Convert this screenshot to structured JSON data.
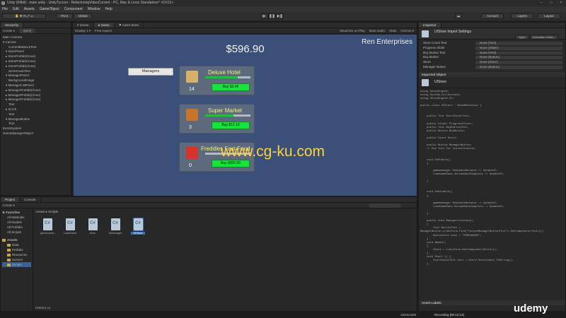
{
  "window": {
    "title": "Unity (64bit) - main.unity - UnityTycoon - RefactoringVideoCurrent - PC, Mac & Linux Standalone* <DX11>",
    "controls": [
      "–",
      "□",
      "×"
    ]
  },
  "menu": [
    "File",
    "Edit",
    "Assets",
    "GameObject",
    "Component",
    "Window",
    "Help"
  ],
  "toolbar": {
    "pivot": "Pivot",
    "global": "Global",
    "account": "Account",
    "layers": "Layers",
    "layout": "Layout",
    "play_buttons": [
      "▶",
      "❚❚",
      "▶❚"
    ]
  },
  "hierarchy": {
    "tab": "Hierarchy",
    "create": "Create ▾",
    "search": "Q▾All",
    "items": [
      "Main Camera",
      "▾ Canvas",
      "CurrentBalanceText",
      "▾ StorePanel",
      "▸ StorePrefab(Clone)",
      "▸ StorePrefab(Clone)",
      "▸ StorePrefab(Clone)",
      "StoreCountText",
      "▾ ManagerPanel",
      "BackgroundImage",
      "▾ ManagerListPanel",
      "▸ ManagerPrefab(Clone)",
      "▸ ManagerPrefab(Clone)",
      "▸ ManagerPrefab(Clone)",
      "Text",
      "▸ Scroll",
      "Text",
      "▾ ManagerButton",
      "Text",
      "EventSystem",
      "GameManagerObject"
    ]
  },
  "scene_tabs": [
    "# Scene",
    "● Game",
    "⚑ Asset Store"
  ],
  "game_bar": {
    "display": "Display 1 ▾",
    "aspect": "Free Aspect",
    "options": [
      "Maximize on Play",
      "Mute audio",
      "Stats",
      "Gizmos ▾"
    ]
  },
  "game": {
    "balance": "$596.90",
    "company": "Ren Enterprises",
    "managers_button": "Managers",
    "stores": [
      {
        "name": "Deluxe Hotel",
        "count": "14",
        "buy": "Buy $3.40",
        "progress": 0.72,
        "icon": "hotel-icon"
      },
      {
        "name": "Super Market",
        "count": "3",
        "buy": "Buy $12.10",
        "progress": 0.62,
        "icon": "market-icon"
      },
      {
        "name": "Freddies Fast Food",
        "count": "0",
        "buy": "Buy $300.00",
        "progress": 0.0,
        "icon": "fries-icon"
      }
    ]
  },
  "watermark": "www.cg-ku.com",
  "project": {
    "tabs": [
      "Project",
      "Console"
    ],
    "create": "Create ▾",
    "breadcrumb": "Assets ▸ Scripts",
    "favorites_label": "Favorites",
    "favorites": [
      "All Materials",
      "All Models",
      "All Prefabs",
      "All Scripts"
    ],
    "assets_label": "Assets",
    "folders": [
      "Data",
      "Prefabs",
      "Resources",
      "Scenes",
      "Scripts"
    ],
    "files": [
      "gamemana...",
      "LoadGame",
      "store",
      "UIManager",
      "UIStore"
    ],
    "selected_file": "UIStore.cs"
  },
  "inspector": {
    "tab": "Inspector",
    "header": "UIStore Import Settings",
    "open": "Open",
    "execution_order": "Execution Order...",
    "fields": [
      {
        "key": "Store Count Text",
        "value": "None (Text)"
      },
      {
        "key": "Progress Slider",
        "value": "None (Slider)"
      },
      {
        "key": "Buy Button Text",
        "value": "None (Text)"
      },
      {
        "key": "Buy Button",
        "value": "None (Button)"
      },
      {
        "key": "Store",
        "value": "None (Store)"
      },
      {
        "key": "Manager Button",
        "value": "None (Button)"
      }
    ],
    "imported_object": "Imported Object",
    "script_name": "UIStore",
    "asset_labels": "Asset Labels",
    "code": [
      "using UnityEngine;",
      "using System.Collections;",
      "using UnityEngine.UI;",
      "",
      "public class UIStore : MonoBehaviour {",
      "",
      "",
      "    public Text StoreCountText;",
      "",
      "    public Slider ProgressSlider;",
      "    public Text BuyButtonText;",
      "    public Button BuyButton;",
      "",
      "    public Store Store;",
      "",
      "    public Button ManagerButton;",
      "    // Use this for initialization",
      "",
      "",
      "    void OnEnable()",
      "    {",
      "",
      "        gamemanager.OnUpdateBalance += UpdateUI;",
      "        LoadGameData.OnLoadDataComplete += UpdateUI;",
      "",
      "    }",
      "",
      "",
      "    void OnDisable()",
      "    {",
      "",
      "        gamemanager.OnUpdateBalance -= UpdateUI;",
      "        LoadGameData.OnLoadDataComplete -= UpdateUI;",
      "",
      "    }",
      "",
      "    public void ManagerUnlocked()",
      "    {",
      "        Text ButtonText =",
      "ManagerButton.transform.Find(\"UnlockManagerButtonText\").GetComponent<Text>();",
      "        ButtonText.text = \"PURCHASED\";",
      "    }",
      "    void Awake()",
      "    {",
      "        Store = transform.GetComponent<Store>();",
      "    }",
      "    void Start () {",
      "        StoreCountText.text = Store.StoreCount.ToString();",
      "    }"
    ]
  },
  "status": {
    "resolution": "1920x1080",
    "recording": "Recording [00:12:13]",
    "brand": "udemy"
  }
}
